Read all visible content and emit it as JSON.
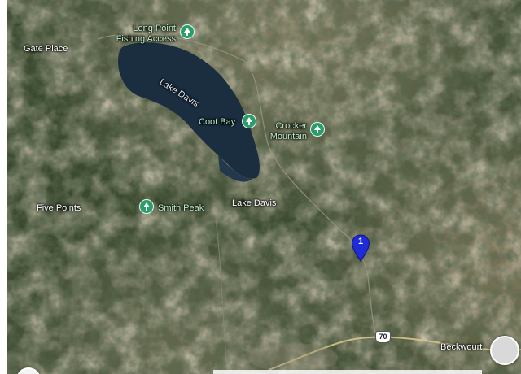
{
  "map": {
    "type": "satellite",
    "colors": {
      "poi": "#2a9d6a",
      "pin": "#1f2bd6",
      "water": "#1a2e40"
    },
    "places": [
      {
        "key": "gate_place",
        "text": "Gate Place"
      },
      {
        "key": "five_points",
        "text": "Five Points"
      },
      {
        "key": "lake_davis_town",
        "text": "Lake Davis"
      },
      {
        "key": "beckwourth",
        "text": "Beckwourt"
      }
    ],
    "water_label": "Lake Davis",
    "pois": [
      {
        "key": "long_point",
        "lines": [
          "Long Point",
          "Fishing Access"
        ],
        "icon": "tree-icon"
      },
      {
        "key": "coot_bay",
        "lines": [
          "Coot Bay"
        ],
        "icon": "tree-icon"
      },
      {
        "key": "crocker_mountain",
        "lines": [
          "Crocker",
          "Mountain"
        ],
        "icon": "tree-icon"
      },
      {
        "key": "smith_peak",
        "lines": [
          "Smith Peak"
        ],
        "icon": "tree-icon"
      }
    ],
    "marker": {
      "number": "1"
    },
    "highway": {
      "number": "70"
    }
  }
}
